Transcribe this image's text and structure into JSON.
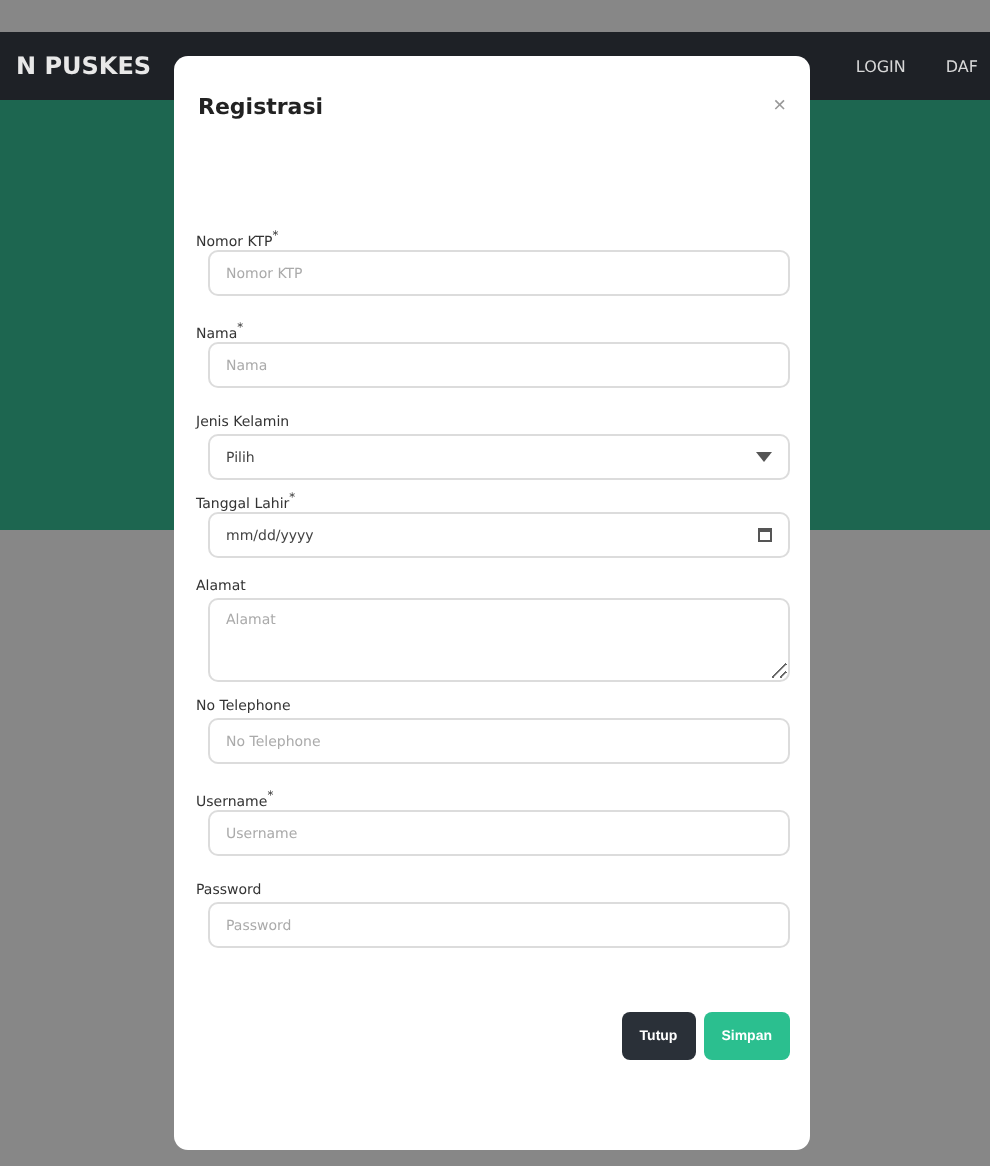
{
  "navbar": {
    "brand": "N PUSKES",
    "links": [
      "LOGIN",
      "DAF"
    ]
  },
  "modal": {
    "title": "Registrasi",
    "close": "×",
    "fields": [
      {
        "kind": "input",
        "label": "Nomor KTP$^{*}$",
        "placeholder": "Nomor KTP"
      },
      {
        "kind": "input",
        "label": "Nama$^{*}$",
        "placeholder": "Nama"
      },
      {
        "kind": "select",
        "label": "Jenis Kelamin",
        "value": "Pilih"
      },
      {
        "kind": "date",
        "label": "Tanggal Lahir$^{*}$",
        "placeholder": "mm/dd/yyyy"
      },
      {
        "kind": "textarea",
        "label": "Alamat",
        "placeholder": "Alamat"
      },
      {
        "kind": "input",
        "label": "No Telephone",
        "placeholder": "No Telephone"
      },
      {
        "kind": "input",
        "label": "Username$^{*}$",
        "placeholder": "Username"
      },
      {
        "kind": "input",
        "label": "Password",
        "placeholder": "Password"
      }
    ],
    "buttons": [
      {
        "label": "Tutup",
        "kind": "secondary"
      },
      {
        "label": "Simpan",
        "kind": "primary"
      }
    ]
  }
}
